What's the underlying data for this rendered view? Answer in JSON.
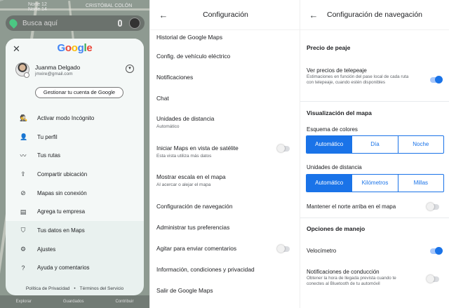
{
  "map": {
    "search_placeholder": "Busca aquí",
    "streets": [
      "Norte 12",
      "Norte 14",
      "CRISTÓBAL COLÓN"
    ],
    "bottom_nav": [
      "Explorar",
      "Guardados",
      "Contribuir"
    ]
  },
  "account_menu": {
    "logo": "Google",
    "user_name": "Juanma Delgado",
    "user_email": "jmxire@gmail.com",
    "manage_button": "Gestionar tu cuenta de Google",
    "items": [
      {
        "icon": "incognito-icon",
        "glyph": "🕵",
        "label": "Activar modo Incógnito"
      },
      {
        "icon": "profile-icon",
        "glyph": "👤",
        "label": "Tu perfil"
      },
      {
        "icon": "timeline-icon",
        "glyph": "〰",
        "label": "Tus rutas"
      },
      {
        "icon": "share-location-icon",
        "glyph": "⇪",
        "label": "Compartir ubicación"
      },
      {
        "icon": "offline-maps-icon",
        "glyph": "⊘",
        "label": "Mapas sin conexión"
      },
      {
        "icon": "business-icon",
        "glyph": "▤",
        "label": "Agrega tu empresa"
      }
    ],
    "lower_items": [
      {
        "icon": "shield-icon",
        "glyph": "⛉",
        "label": "Tus datos en Maps"
      },
      {
        "icon": "gear-icon",
        "glyph": "⚙",
        "label": "Ajustes"
      },
      {
        "icon": "help-icon",
        "glyph": "?",
        "label": "Ayuda y comentarios"
      }
    ],
    "footer": {
      "privacy": "Política de Privacidad",
      "terms": "Términos del Servicio"
    }
  },
  "settings": {
    "title": "Configuración",
    "items": [
      {
        "label": "Historial de Google Maps",
        "sub": "",
        "toggle": null
      },
      {
        "label": "Config. de vehículo eléctrico",
        "sub": "",
        "toggle": null
      },
      {
        "label": "Notificaciones",
        "sub": "",
        "toggle": null
      },
      {
        "label": "Chat",
        "sub": "",
        "toggle": null
      },
      {
        "label": "Unidades de distancia",
        "sub": "Automático",
        "toggle": null
      },
      {
        "label": "Iniciar Maps en vista de satélite",
        "sub": "Esta vista utiliza más datos",
        "toggle": false
      },
      {
        "label": "Mostrar escala en el mapa",
        "sub": "Al acercar o alejar el mapa",
        "toggle": null
      },
      {
        "label": "Configuración de navegación",
        "sub": "",
        "toggle": null
      },
      {
        "label": "Administrar tus preferencias",
        "sub": "",
        "toggle": null
      },
      {
        "label": "Agitar para enviar comentarios",
        "sub": "",
        "toggle": false
      },
      {
        "label": "Información, condiciones y privacidad",
        "sub": "",
        "toggle": null
      },
      {
        "label": "Salir de Google Maps",
        "sub": "",
        "toggle": null
      }
    ]
  },
  "nav_settings": {
    "title": "Configuración de navegación",
    "toll_section": "Precio de peaje",
    "toll_label": "Ver precios de telepeaje",
    "toll_desc": "Estimaciones en función del pase local de cada ruta con telepeaje, cuando estén disponibles",
    "toll_on": true,
    "map_section": "Visualización del mapa",
    "color_label": "Esquema de colores",
    "color_options": [
      "Automático",
      "Día",
      "Noche"
    ],
    "color_selected": "Automático",
    "units_label": "Unidades de distancia",
    "units_options": [
      "Automático",
      "Kilómetros",
      "Millas"
    ],
    "units_selected": "Automático",
    "north_label": "Mantener el norte arriba en el mapa",
    "north_on": false,
    "driving_section": "Opciones de manejo",
    "speedometer_label": "Velocímetro",
    "speedometer_on": true,
    "driving_notif_label": "Notificaciones de conducción",
    "driving_notif_desc": "Obtener la hora de llegada prevista cuando te conectes al Bluetooth de tu automóvil",
    "driving_notif_on": false
  },
  "colors": {
    "accent": "#1a73e8",
    "card_bg": "#e9f1ef",
    "map_overlay": "#7c8a80"
  }
}
